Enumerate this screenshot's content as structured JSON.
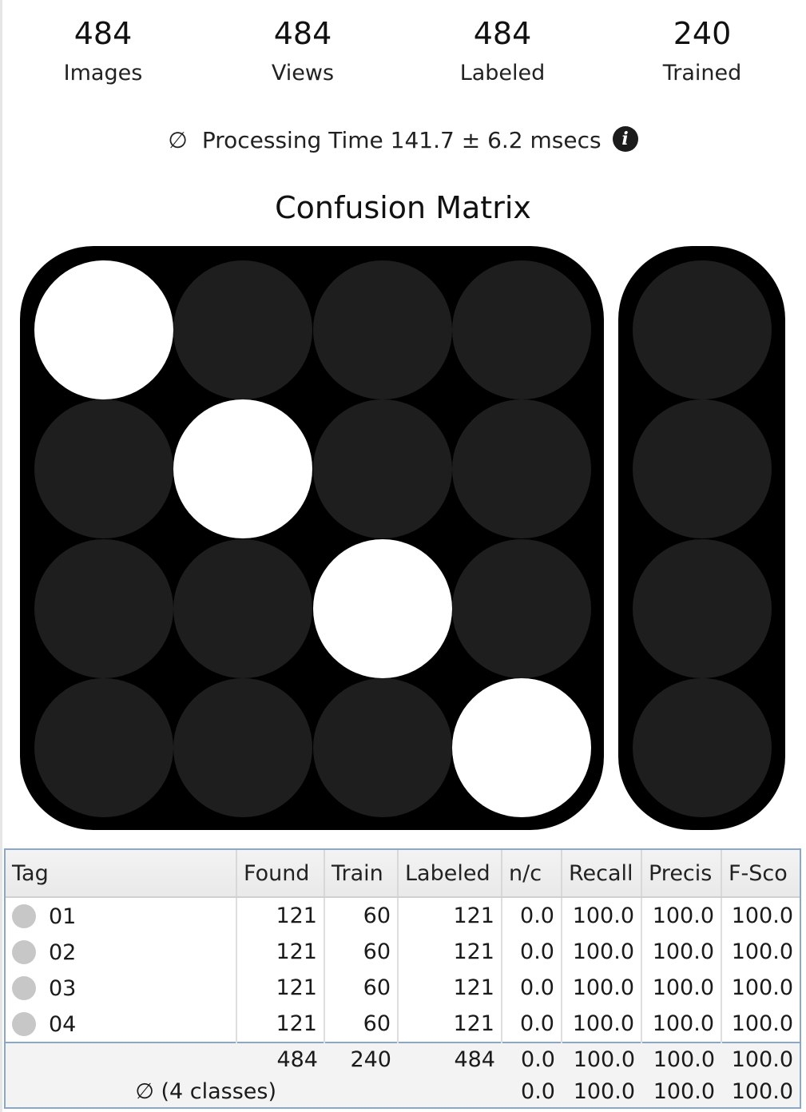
{
  "stats": [
    {
      "value": "484",
      "label": "Images"
    },
    {
      "value": "484",
      "label": "Views"
    },
    {
      "value": "484",
      "label": "Labeled"
    },
    {
      "value": "240",
      "label": "Trained"
    }
  ],
  "processing": {
    "symbol": "∅",
    "text": "Processing Time 141.7 ± 6.2 msecs",
    "info_icon": "i"
  },
  "confusion_matrix": {
    "title": "Confusion Matrix",
    "size": 4,
    "diagonal_color": "#ffffff",
    "off_diagonal_color": "#1e1e1e",
    "background_color": "#000000",
    "cells": [
      [
        1,
        0,
        0,
        0
      ],
      [
        0,
        1,
        0,
        0
      ],
      [
        0,
        0,
        1,
        0
      ],
      [
        0,
        0,
        0,
        1
      ]
    ],
    "side_column": [
      0,
      0,
      0,
      0
    ]
  },
  "table": {
    "headers": [
      "Tag",
      "Found",
      "Train",
      "Labeled",
      "n/c",
      "Recall",
      "Precis",
      "F-Sco"
    ],
    "rows": [
      {
        "tag": "01",
        "found": "121",
        "train": "60",
        "labeled": "121",
        "nc": "0.0",
        "recall": "100.0",
        "precision": "100.0",
        "fscore": "100.0"
      },
      {
        "tag": "02",
        "found": "121",
        "train": "60",
        "labeled": "121",
        "nc": "0.0",
        "recall": "100.0",
        "precision": "100.0",
        "fscore": "100.0"
      },
      {
        "tag": "03",
        "found": "121",
        "train": "60",
        "labeled": "121",
        "nc": "0.0",
        "recall": "100.0",
        "precision": "100.0",
        "fscore": "100.0"
      },
      {
        "tag": "04",
        "found": "121",
        "train": "60",
        "labeled": "121",
        "nc": "0.0",
        "recall": "100.0",
        "precision": "100.0",
        "fscore": "100.0"
      }
    ],
    "totals": {
      "found": "484",
      "train": "240",
      "labeled": "484",
      "nc": "0.0",
      "recall": "100.0",
      "precision": "100.0",
      "fscore": "100.0"
    },
    "average": {
      "label": "∅ (4 classes)",
      "nc": "0.0",
      "recall": "100.0",
      "precision": "100.0",
      "fscore": "100.0"
    },
    "tag_dot_color": "#c7c7c7"
  }
}
